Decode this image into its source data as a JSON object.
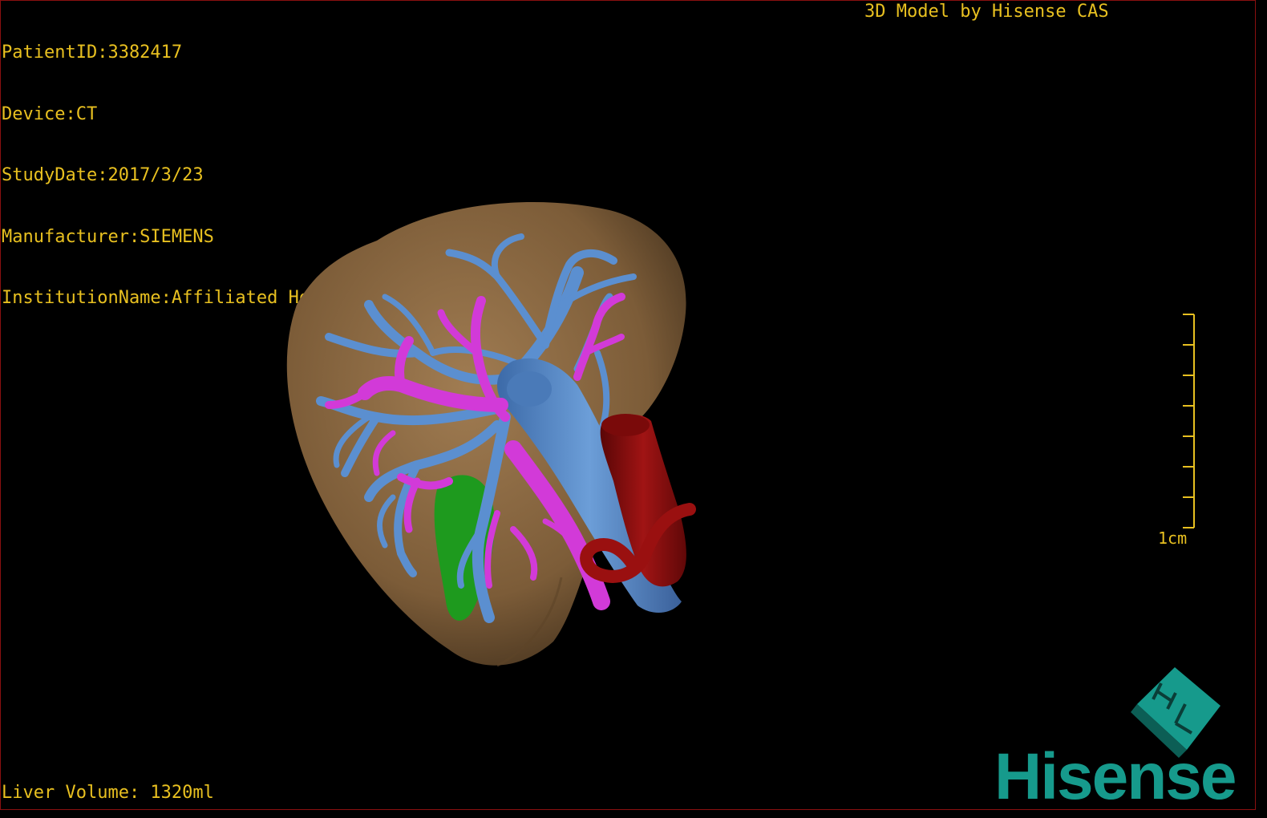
{
  "header": {
    "patient_id": "PatientID:3382417",
    "device": "Device:CT",
    "study_date": "StudyDate:2017/3/23",
    "manufacturer": "Manufacturer:SIEMENS",
    "institution": "InstitutionName:Affiliated Hospital Qingdao University-C"
  },
  "credit": "3D Model by Hisense CAS",
  "footer": {
    "liver_volume": "Liver Volume: 1320ml"
  },
  "scale_bar": {
    "label": "1cm",
    "ticks": 8
  },
  "logo": {
    "brand": "Hisense",
    "mark_text": "HL"
  },
  "colors": {
    "overlay_text": "#e8c020",
    "liver": "#8b6a45",
    "hepatic_vein": "#5b8fd0",
    "portal_vein": "#d23ad8",
    "aorta": "#8e0e0e",
    "gallbladder": "#1e9a1e",
    "brand": "#169a8c"
  }
}
